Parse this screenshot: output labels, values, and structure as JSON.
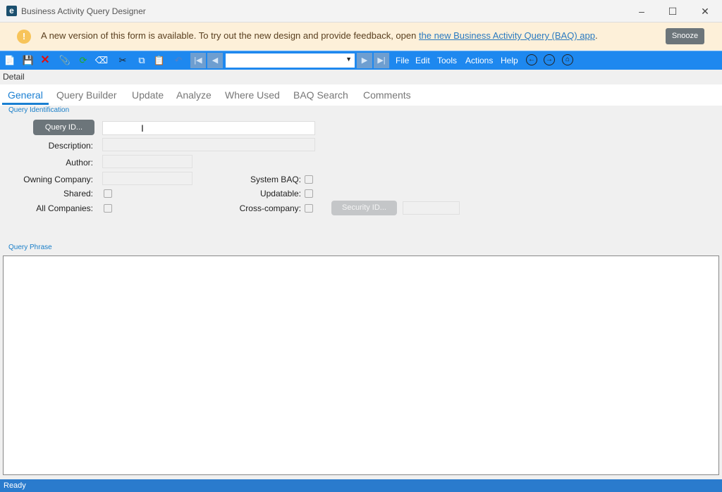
{
  "window": {
    "title": "Business Activity Query Designer",
    "logo": "e"
  },
  "banner": {
    "text": "A new version of this form is available. To try out the new design and provide feedback, open ",
    "link": "the new Business Activity Query (BAQ) app",
    "link_suffix": ".",
    "snooze": "Snooze"
  },
  "menu": [
    "File",
    "Edit",
    "Tools",
    "Actions",
    "Help"
  ],
  "detail_label": "Detail",
  "tabs": [
    "General",
    "Query Builder",
    "Update",
    "Analyze",
    "Where Used",
    "BAQ Search",
    "Comments"
  ],
  "form": {
    "group_title": "Query Identification",
    "query_id_button": "Query ID...",
    "description_label": "Description:",
    "author_label": "Author:",
    "owning_company_label": "Owning Company:",
    "shared_label": "Shared:",
    "all_companies_label": "All Companies:",
    "system_baq_label": "System BAQ:",
    "updatable_label": "Updatable:",
    "cross_company_label": "Cross-company:",
    "security_id_button": "Security ID...",
    "query_id_value": "",
    "description_value": "",
    "author_value": "",
    "owning_company_value": "",
    "security_id_value": ""
  },
  "query_phrase_title": "Query Phrase",
  "status": "Ready"
}
